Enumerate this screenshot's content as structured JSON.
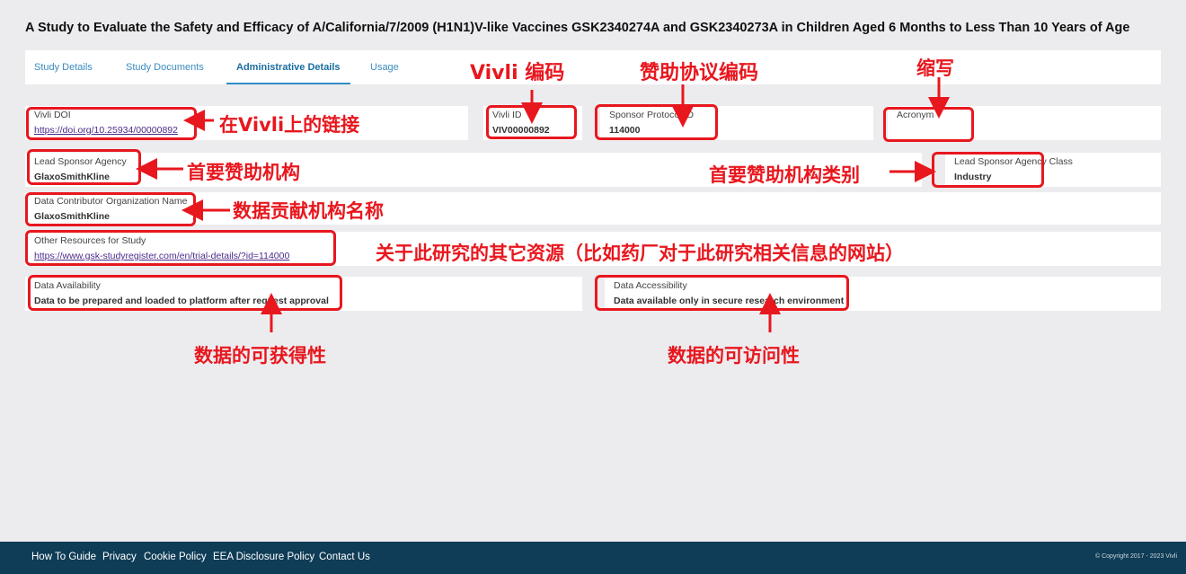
{
  "title": "A Study to Evaluate the Safety and Efficacy of A/California/7/2009 (H1N1)V-like Vaccines GSK2340274A and GSK2340273A in Children Aged 6 Months to Less Than 10 Years of Age",
  "tabs": [
    "Study Details",
    "Study Documents",
    "Administrative Details",
    "Usage"
  ],
  "active_tab": "Administrative Details",
  "fields": {
    "vivli_doi": {
      "label": "Vivli DOI",
      "value": "https://doi.org/10.25934/00000892"
    },
    "vivli_id": {
      "label": "Vivli ID",
      "value": "VIV00000892"
    },
    "sponsor_protocol_id": {
      "label": "Sponsor Protocol ID",
      "value": "114000"
    },
    "acronym": {
      "label": "Acronym",
      "value": ""
    },
    "lead_sponsor_agency": {
      "label": "Lead Sponsor Agency",
      "value": "GlaxoSmithKline"
    },
    "lead_sponsor_agency_class": {
      "label": "Lead Sponsor Agency Class",
      "value": "Industry"
    },
    "data_contributor_org": {
      "label": "Data Contributor Organization Name",
      "value": "GlaxoSmithKline"
    },
    "other_resources": {
      "label": "Other Resources for Study",
      "value": "https://www.gsk-studyregister.com/en/trial-details/?id=114000"
    },
    "data_availability": {
      "label": "Data Availability",
      "value": "Data to be prepared and loaded to platform after request approval"
    },
    "data_accessibility": {
      "label": "Data Accessibility",
      "value": "Data available only in secure research environment"
    }
  },
  "annotations": {
    "vivli_id": "Vivli 编码",
    "sponsor_protocol": "赞助协议编码",
    "acronym": "缩写",
    "doi": "在Vivli上的链接",
    "lead_sponsor": "首要赞助机构",
    "lead_sponsor_class": "首要赞助机构类别",
    "contributor": "数据贡献机构名称",
    "other_resources": "关于此研究的其它资源（比如药厂对于此研究相关信息的网站）",
    "availability": "数据的可获得性",
    "accessibility": "数据的可访问性"
  },
  "annotation_color": "#e8171e",
  "footer": {
    "links": [
      "How To Guide",
      "Privacy",
      "Cookie Policy",
      "EEA Disclosure Policy",
      "Contact Us"
    ],
    "copyright": "© Copyright 2017 - 2023 Vivli"
  }
}
